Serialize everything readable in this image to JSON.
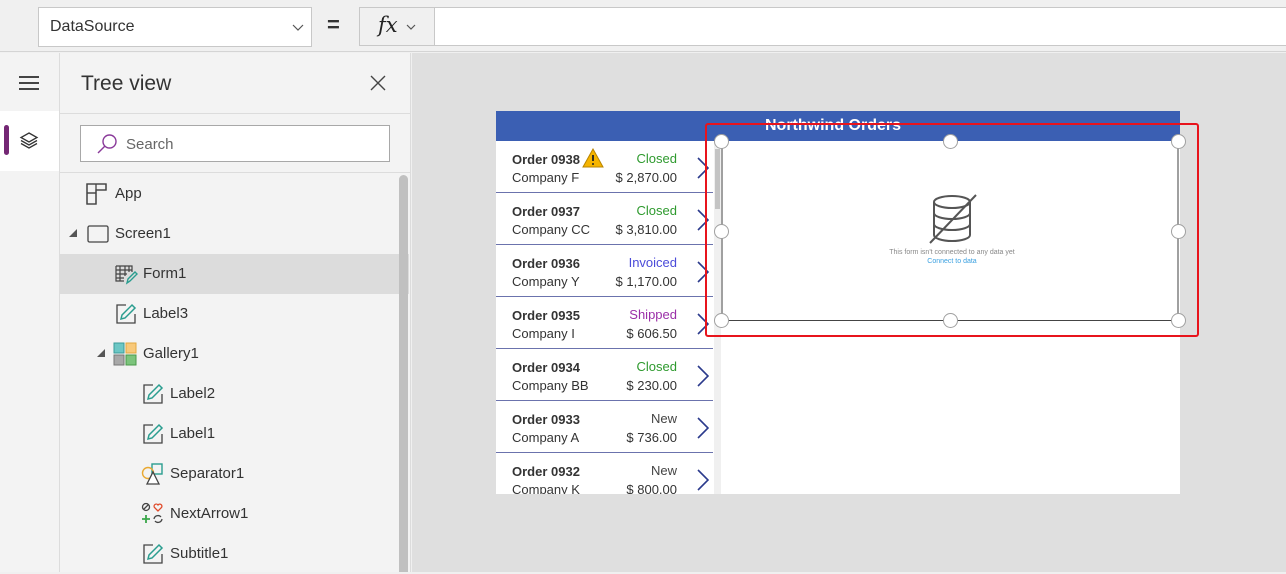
{
  "formula_bar": {
    "property": "DataSource",
    "equals": "=",
    "fx_label": "fx",
    "formula": ""
  },
  "rail": {
    "menu_icon": "hamburger-icon",
    "active_item": "layers-icon"
  },
  "tree_view": {
    "title": "Tree view",
    "search_placeholder": "Search",
    "nodes": [
      {
        "label": "App",
        "icon": "app-icon",
        "level": 0,
        "expandable": false
      },
      {
        "label": "Screen1",
        "icon": "screen-icon",
        "level": 0,
        "expandable": true
      },
      {
        "label": "Form1",
        "icon": "form-icon",
        "level": 1,
        "expandable": false,
        "selected": true
      },
      {
        "label": "Label3",
        "icon": "label-icon",
        "level": 1,
        "expandable": false
      },
      {
        "label": "Gallery1",
        "icon": "gallery-icon",
        "level": 1,
        "expandable": true
      },
      {
        "label": "Label2",
        "icon": "label-icon",
        "level": 2,
        "expandable": false
      },
      {
        "label": "Label1",
        "icon": "label-icon",
        "level": 2,
        "expandable": false
      },
      {
        "label": "Separator1",
        "icon": "shapes-icon",
        "level": 2,
        "expandable": false
      },
      {
        "label": "NextArrow1",
        "icon": "icons-icon",
        "level": 2,
        "expandable": false
      },
      {
        "label": "Subtitle1",
        "icon": "label-icon",
        "level": 2,
        "expandable": false
      }
    ]
  },
  "app": {
    "title": "Northwind Orders",
    "orders": [
      {
        "order": "Order 0938",
        "company": "Company F",
        "status": "Closed",
        "amount": "$ 2,870.00",
        "warning": true
      },
      {
        "order": "Order 0937",
        "company": "Company CC",
        "status": "Closed",
        "amount": "$ 3,810.00"
      },
      {
        "order": "Order 0936",
        "company": "Company Y",
        "status": "Invoiced",
        "amount": "$ 1,170.00"
      },
      {
        "order": "Order 0935",
        "company": "Company I",
        "status": "Shipped",
        "amount": "$ 606.50"
      },
      {
        "order": "Order 0934",
        "company": "Company BB",
        "status": "Closed",
        "amount": "$ 230.00"
      },
      {
        "order": "Order 0933",
        "company": "Company A",
        "status": "New",
        "amount": "$ 736.00"
      },
      {
        "order": "Order 0932",
        "company": "Company K",
        "status": "New",
        "amount": "$ 800.00"
      }
    ],
    "status_colors": {
      "Closed": "#2e9a2e",
      "Invoiced": "#4b4bd9",
      "Shipped": "#9b2fa8",
      "New": "#444444"
    },
    "form": {
      "empty_message": "This form isn't connected to any data yet",
      "connect_link": "Connect to data"
    }
  },
  "colors": {
    "accent": "#742774",
    "header_blue": "#3b5fb3",
    "selection_red": "#e8141c"
  }
}
